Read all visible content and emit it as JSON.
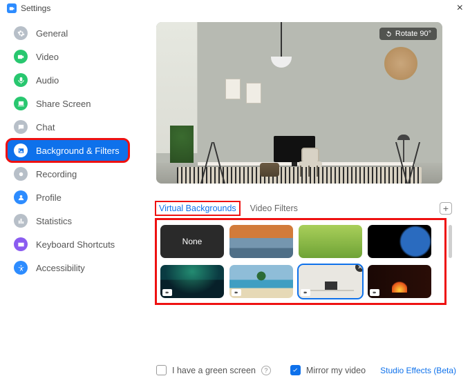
{
  "window": {
    "title": "Settings"
  },
  "sidebar": {
    "items": [
      {
        "label": "General",
        "icon": "gear",
        "color": "#b7bfc8"
      },
      {
        "label": "Video",
        "icon": "video",
        "color": "#28c76f"
      },
      {
        "label": "Audio",
        "icon": "audio",
        "color": "#28c76f"
      },
      {
        "label": "Share Screen",
        "icon": "share",
        "color": "#28c76f"
      },
      {
        "label": "Chat",
        "icon": "chat",
        "color": "#b7bfc8"
      },
      {
        "label": "Background & Filters",
        "icon": "background",
        "color": "#0e71eb",
        "active": true,
        "highlight": true
      },
      {
        "label": "Recording",
        "icon": "recording",
        "color": "#b7bfc8"
      },
      {
        "label": "Profile",
        "icon": "profile",
        "color": "#2d8cff"
      },
      {
        "label": "Statistics",
        "icon": "stats",
        "color": "#b7bfc8"
      },
      {
        "label": "Keyboard Shortcuts",
        "icon": "keyboard",
        "color": "#8a5cf0"
      },
      {
        "label": "Accessibility",
        "icon": "accessibility",
        "color": "#2d8cff"
      }
    ]
  },
  "preview": {
    "rotate_label": "Rotate 90°"
  },
  "tabs": {
    "virtual_backgrounds": "Virtual Backgrounds",
    "video_filters": "Video Filters",
    "active": "virtual_backgrounds"
  },
  "backgrounds": {
    "none_label": "None",
    "items": [
      {
        "id": "none",
        "kind": "none"
      },
      {
        "id": "bridge",
        "kind": "image"
      },
      {
        "id": "grass",
        "kind": "image"
      },
      {
        "id": "earth",
        "kind": "image"
      },
      {
        "id": "aurora",
        "kind": "video"
      },
      {
        "id": "beach",
        "kind": "video"
      },
      {
        "id": "office",
        "kind": "video",
        "selected": true,
        "removable": true
      },
      {
        "id": "fire",
        "kind": "video"
      }
    ]
  },
  "footer": {
    "green_screen_label": "I have a green screen",
    "green_screen_checked": false,
    "mirror_label": "Mirror my video",
    "mirror_checked": true,
    "studio_effects": "Studio Effects (Beta)"
  }
}
